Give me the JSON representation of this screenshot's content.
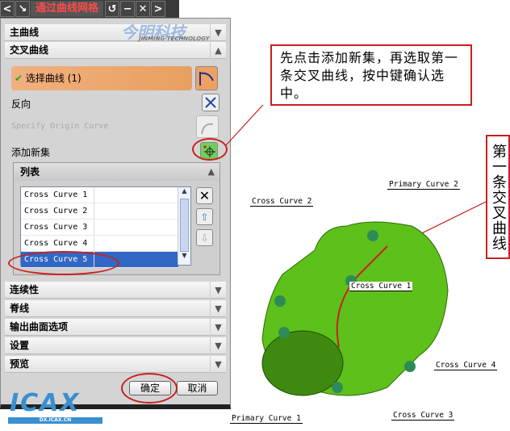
{
  "titlebar": {
    "title": "通过曲线网格"
  },
  "watermark": {
    "brand": "今明科技",
    "sub": "JINMING TECHNOLOGY",
    "logo": "ICAX",
    "logo_url": "DX.ICAX.CN"
  },
  "sections": {
    "primary": "主曲线",
    "cross": "交叉曲线",
    "continuity": "连续性",
    "spine": "脊线",
    "output": "输出曲面选项",
    "settings": "设置",
    "preview": "预览",
    "list": "列表"
  },
  "cross": {
    "select_curve": "选择曲线 (1)",
    "reverse": "反向",
    "origin": "Specify Origin Curve",
    "add_set": "添加新集"
  },
  "list_items": [
    "Cross Curve  1",
    "Cross Curve  2",
    "Cross Curve  3",
    "Cross Curve  4",
    "Cross Curve  5"
  ],
  "buttons": {
    "ok": "确定",
    "cancel": "取消"
  },
  "callout": {
    "text": "先点击添加新集，再选取第一条交叉曲线，按中键确认选中。",
    "vertical": "第一条交叉曲线"
  },
  "viewport_labels": {
    "p2": "Primary Curve  2",
    "c2": "Cross Curve  2",
    "c1": "Cross Curve  1",
    "c4": "Cross Curve  4",
    "c3": "Cross Curve  3",
    "p1": "Primary Curve  1"
  },
  "colors": {
    "accent": "#3168c6",
    "annotation": "#c82020",
    "model": "#5ec01a"
  }
}
